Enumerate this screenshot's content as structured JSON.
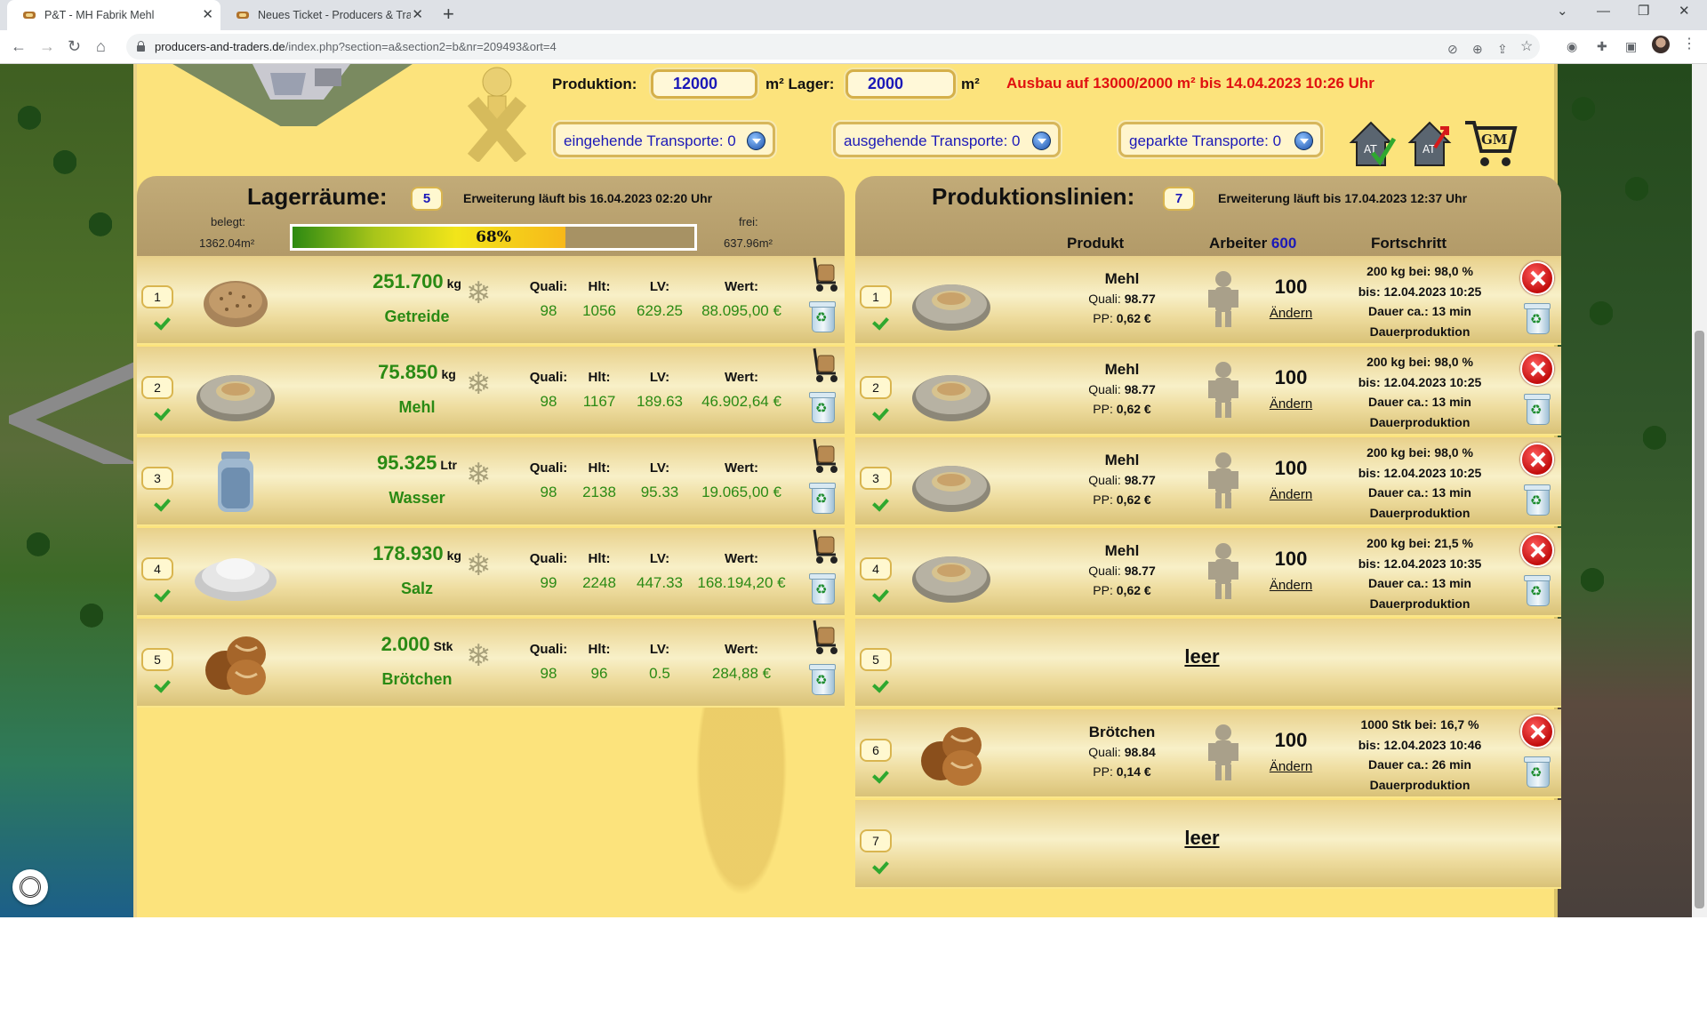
{
  "browser": {
    "tabs": [
      {
        "title": "P&T - MH Fabrik Mehl",
        "close": "✕"
      },
      {
        "title": "Neues Ticket - Producers & Trade",
        "close": "✕"
      }
    ],
    "new_tab": "+",
    "window_controls": [
      "⌄",
      "—",
      "❐",
      "✕"
    ],
    "url_host": "producers-and-traders.de",
    "url_path": "/index.php?section=a&section2=b&nr=209493&ort=4",
    "nav": {
      "back": "←",
      "forward": "→",
      "reload": "↻",
      "home": "⌂"
    },
    "toolbar_icons": [
      "eye-off-icon",
      "zoom-icon",
      "share-icon",
      "star-icon",
      "extension-alert-icon",
      "puzzle-icon",
      "sidepanel-icon",
      "avatar",
      "menu-icon"
    ]
  },
  "header": {
    "produktion_label": "Produktion:",
    "produktion_value": "12000",
    "m2_lager_label": "m² Lager:",
    "lager_value": "2000",
    "m2_label": "m²",
    "ausbau_text": "Ausbau auf 13000/2000 m² bis 14.04.2023 10:26 Uhr",
    "transports": [
      {
        "label": "eingehende Transporte: 0"
      },
      {
        "label": "ausgehende Transporte: 0"
      },
      {
        "label": "geparkte Transporte: 0"
      }
    ],
    "icons": [
      "house-check-icon",
      "house-up-icon",
      "gm-cart-icon"
    ],
    "gm_label": "GM"
  },
  "lager": {
    "title": "Lagerräume:",
    "count": "5",
    "erweiterung": "Erweiterung läuft bis 16.04.2023 02:20 Uhr",
    "belegt_label": "belegt:",
    "belegt_value": "1362.04m²",
    "frei_label": "frei:",
    "frei_value": "637.96m²",
    "fill_percent": 68,
    "fill_text": "68%",
    "col_labels": {
      "quali": "Quali:",
      "hlt": "Hlt:",
      "lv": "LV:",
      "wert": "Wert:"
    },
    "rows": [
      {
        "num": "1",
        "qty": "251.700",
        "unit": "kg",
        "name": "Getreide",
        "icon": "grain-icon",
        "quali": "98",
        "hlt": "1056",
        "lv": "629.25",
        "wert": "88.095,00 €"
      },
      {
        "num": "2",
        "qty": "75.850",
        "unit": "kg",
        "name": "Mehl",
        "icon": "flour-icon",
        "quali": "98",
        "hlt": "1167",
        "lv": "189.63",
        "wert": "46.902,64 €"
      },
      {
        "num": "3",
        "qty": "95.325",
        "unit": "Ltr",
        "name": "Wasser",
        "icon": "water-jar-icon",
        "quali": "98",
        "hlt": "2138",
        "lv": "95.33",
        "wert": "19.065,00 €"
      },
      {
        "num": "4",
        "qty": "178.930",
        "unit": "kg",
        "name": "Salz",
        "icon": "salt-icon",
        "quali": "99",
        "hlt": "2248",
        "lv": "447.33",
        "wert": "168.194,20 €"
      },
      {
        "num": "5",
        "qty": "2.000",
        "unit": "Stk",
        "name": "Brötchen",
        "icon": "bread-rolls-icon",
        "quali": "98",
        "hlt": "96",
        "lv": "0.5",
        "wert": "284,88 €"
      }
    ]
  },
  "produktion": {
    "title": "Produktionslinien:",
    "count": "7",
    "erweiterung": "Erweiterung läuft bis 17.04.2023 12:37 Uhr",
    "col_produkt": "Produkt",
    "col_arbeiter": "Arbeiter",
    "arbeiter_total": "600",
    "col_fortschritt": "Fortschritt",
    "quali_label": "Quali:",
    "pp_label": "PP:",
    "aendern": "Ändern",
    "leer": "leer",
    "lines": [
      {
        "num": "1",
        "product": "Mehl",
        "quali": "98.77",
        "pp": "0,62 €",
        "workers": "100",
        "p1": "200 kg bei: 98,0 %",
        "p2": "bis: 12.04.2023 10:25",
        "p3": "Dauer ca.: 13 min",
        "p4": "Dauerproduktion"
      },
      {
        "num": "2",
        "product": "Mehl",
        "quali": "98.77",
        "pp": "0,62 €",
        "workers": "100",
        "p1": "200 kg bei: 98,0 %",
        "p2": "bis: 12.04.2023 10:25",
        "p3": "Dauer ca.: 13 min",
        "p4": "Dauerproduktion"
      },
      {
        "num": "3",
        "product": "Mehl",
        "quali": "98.77",
        "pp": "0,62 €",
        "workers": "100",
        "p1": "200 kg bei: 98,0 %",
        "p2": "bis: 12.04.2023 10:25",
        "p3": "Dauer ca.: 13 min",
        "p4": "Dauerproduktion"
      },
      {
        "num": "4",
        "product": "Mehl",
        "quali": "98.77",
        "pp": "0,62 €",
        "workers": "100",
        "p1": "200 kg bei: 21,5 %",
        "p2": "bis: 12.04.2023 10:35",
        "p3": "Dauer ca.: 13 min",
        "p4": "Dauerproduktion"
      },
      {
        "num": "5",
        "empty": true
      },
      {
        "num": "6",
        "product": "Brötchen",
        "quali": "98.84",
        "pp": "0,14 €",
        "workers": "100",
        "p1": "1000 Stk bei: 16,7 %",
        "p2": "bis: 12.04.2023 10:46",
        "p3": "Dauer ca.: 26 min",
        "p4": "Dauerproduktion"
      },
      {
        "num": "7",
        "empty": true
      }
    ]
  },
  "colors": {
    "accent_blue": "#1b19b8",
    "green_text": "#2a8a14",
    "alert_red": "#e01010",
    "page_yellow": "#fce37c",
    "panel_brown": "#b9a170"
  }
}
